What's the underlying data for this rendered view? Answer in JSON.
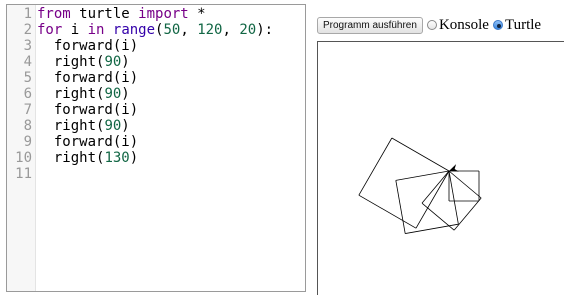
{
  "editor": {
    "lines": [
      [
        {
          "t": "from",
          "c": "kw"
        },
        {
          "t": " turtle ",
          "c": "tx"
        },
        {
          "t": "import",
          "c": "kw"
        },
        {
          "t": " *",
          "c": "tx"
        }
      ],
      [
        {
          "t": "for",
          "c": "kw"
        },
        {
          "t": " i ",
          "c": "tx"
        },
        {
          "t": "in",
          "c": "kw"
        },
        {
          "t": " ",
          "c": "tx"
        },
        {
          "t": "range",
          "c": "bi"
        },
        {
          "t": "(",
          "c": "tx"
        },
        {
          "t": "50",
          "c": "num"
        },
        {
          "t": ", ",
          "c": "tx"
        },
        {
          "t": "120",
          "c": "num"
        },
        {
          "t": ", ",
          "c": "tx"
        },
        {
          "t": "20",
          "c": "num"
        },
        {
          "t": "):",
          "c": "tx"
        }
      ],
      [
        {
          "t": "  forward(i)",
          "c": "tx"
        }
      ],
      [
        {
          "t": "  right(",
          "c": "tx"
        },
        {
          "t": "90",
          "c": "num"
        },
        {
          "t": ")",
          "c": "tx"
        }
      ],
      [
        {
          "t": "  forward(i)",
          "c": "tx"
        }
      ],
      [
        {
          "t": "  right(",
          "c": "tx"
        },
        {
          "t": "90",
          "c": "num"
        },
        {
          "t": ")",
          "c": "tx"
        }
      ],
      [
        {
          "t": "  forward(i)",
          "c": "tx"
        }
      ],
      [
        {
          "t": "  right(",
          "c": "tx"
        },
        {
          "t": "90",
          "c": "num"
        },
        {
          "t": ")",
          "c": "tx"
        }
      ],
      [
        {
          "t": "  forward(i)",
          "c": "tx"
        }
      ],
      [
        {
          "t": "  right(",
          "c": "tx"
        },
        {
          "t": "130",
          "c": "num"
        },
        {
          "t": ")",
          "c": "tx"
        }
      ],
      []
    ]
  },
  "toolbar": {
    "run_label": "Programm ausführen",
    "console_label": "Konsole",
    "turtle_label": "Turtle",
    "selected_mode": "Turtle"
  },
  "colors": {
    "keyword": "#770088",
    "builtin": "#3300aa",
    "number": "#116644",
    "line_number": "#999999"
  },
  "turtle_drawing": {
    "program": {
      "range_start": 50,
      "range_stop": 120,
      "range_step": 20,
      "turn_in_loop": 90,
      "turn_after_square": 130
    },
    "pen_color": "#000000",
    "cursor_icon": "turtle-arrow-icon"
  }
}
